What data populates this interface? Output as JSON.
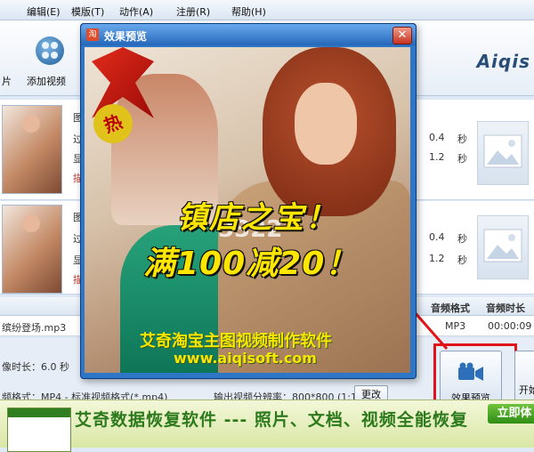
{
  "menu": [
    "编辑(E)",
    "模版(T)",
    "动作(A)",
    "注册(R)",
    "帮助(H)"
  ],
  "toolbar": {
    "left_label": "片",
    "add_video_label": "添加视频",
    "brand": "Aiqis"
  },
  "rows": [
    {
      "labels_left": [
        "图",
        "过",
        "显",
        "描"
      ],
      "values_right": [
        {
          "value": "0.4",
          "unit": "秒"
        },
        {
          "value": "1.2",
          "unit": "秒"
        }
      ]
    },
    {
      "labels_left": [
        "图",
        "过",
        "显",
        "描"
      ],
      "values_right": [
        {
          "value": "0.4",
          "unit": "秒"
        },
        {
          "value": "1.2",
          "unit": "秒"
        }
      ]
    }
  ],
  "audio": {
    "headers": [
      "音频格式",
      "音频时长"
    ],
    "file_name": "缤纷登场.mp3",
    "format": "MP3",
    "duration": "00:00:09"
  },
  "settings": {
    "image_duration_label": "像时长：6.0 秒",
    "video_format_label": "频格式：MP4 - 标准视频格式(*.mp4)",
    "resolution_label": "输出视频分辨率：800*800 (1:1)",
    "change_button": "更改",
    "preview_button": "效果预览",
    "start_button": "开始"
  },
  "dialog": {
    "title": "效果预览",
    "close": "✕",
    "icon_text": "淘",
    "hot": "热",
    "watermark": "3322",
    "line1": "镇店之宝！",
    "line2": "满100减20！",
    "product_name": "艾奇淘宝主图视频制作软件",
    "url": "www.aiqisoft.com"
  },
  "ad": {
    "text": "艾奇数据恢复软件 --- 照片、文档、视频全能恢复",
    "button": "立即体"
  },
  "colors": {
    "accent": "#2e76c7",
    "highlight": "#e0131b",
    "ad_green": "#2c7a1c",
    "promo_yellow": "#ffe600"
  }
}
